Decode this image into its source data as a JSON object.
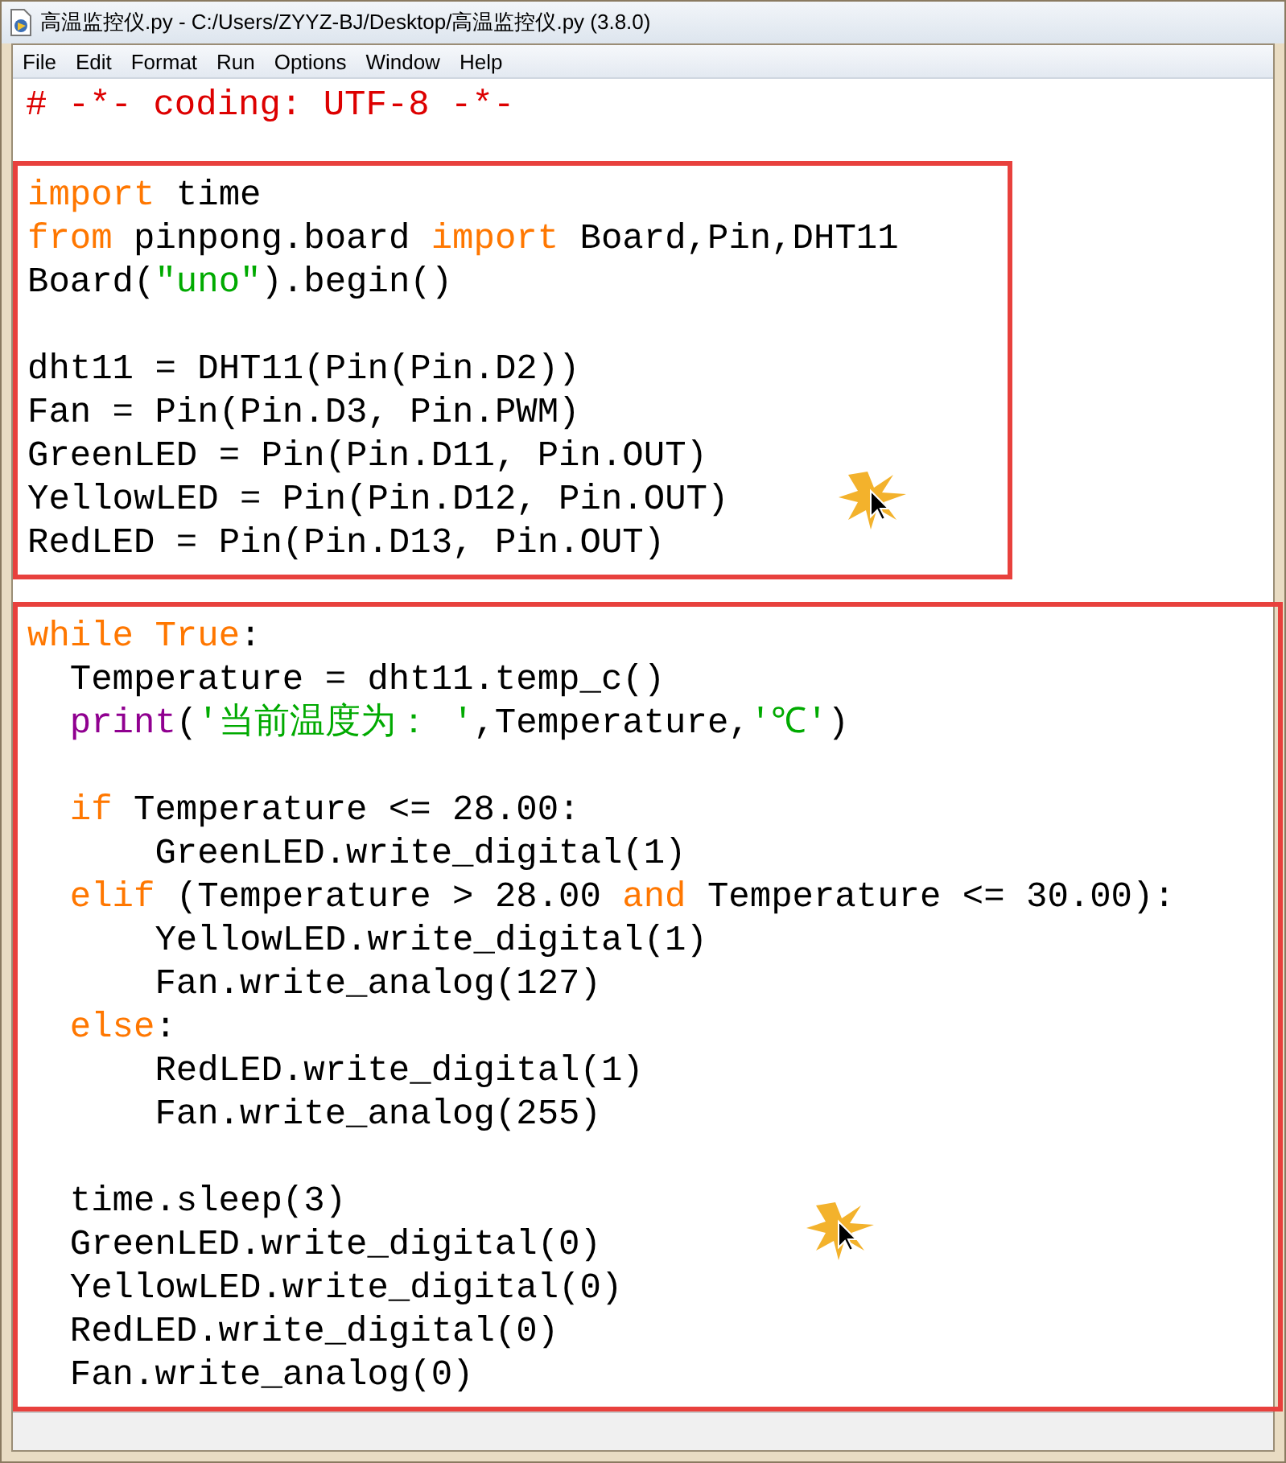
{
  "window": {
    "title": "高温监控仪.py - C:/Users/ZYYZ-BJ/Desktop/高温监控仪.py (3.8.0)"
  },
  "menu": [
    "File",
    "Edit",
    "Format",
    "Run",
    "Options",
    "Window",
    "Help"
  ],
  "header": [
    {
      "kind": "code",
      "tokens": [
        {
          "kind": "comment",
          "text": "# -*- coding: UTF-8 -*-"
        }
      ]
    },
    {
      "kind": "blank"
    }
  ],
  "sections": [
    {
      "lines": [
        {
          "kind": "code",
          "tokens": [
            {
              "kind": "keyword",
              "text": "import"
            },
            {
              "kind": "plain",
              "text": " time"
            }
          ]
        },
        {
          "kind": "code",
          "tokens": [
            {
              "kind": "keyword",
              "text": "from"
            },
            {
              "kind": "plain",
              "text": " pinpong.board "
            },
            {
              "kind": "keyword",
              "text": "import"
            },
            {
              "kind": "plain",
              "text": " Board,Pin,DHT11"
            }
          ]
        },
        {
          "kind": "code",
          "tokens": [
            {
              "kind": "plain",
              "text": "Board("
            },
            {
              "kind": "string",
              "text": "\"uno\""
            },
            {
              "kind": "plain",
              "text": ").begin()"
            }
          ]
        },
        {
          "kind": "blank"
        },
        {
          "kind": "code",
          "tokens": [
            {
              "kind": "plain",
              "text": "dht11 = DHT11(Pin(Pin.D2))"
            }
          ]
        },
        {
          "kind": "code",
          "tokens": [
            {
              "kind": "plain",
              "text": "Fan = Pin(Pin.D3, Pin.PWM)"
            }
          ]
        },
        {
          "kind": "code",
          "tokens": [
            {
              "kind": "plain",
              "text": "GreenLED = Pin(Pin.D11, Pin.OUT)"
            }
          ]
        },
        {
          "kind": "code",
          "tokens": [
            {
              "kind": "plain",
              "text": "YellowLED = Pin(Pin.D12, Pin.OUT)"
            }
          ]
        },
        {
          "kind": "code",
          "tokens": [
            {
              "kind": "plain",
              "text": "RedLED = Pin(Pin.D13, Pin.OUT)"
            }
          ]
        }
      ]
    },
    {
      "lines": [
        {
          "kind": "code",
          "tokens": [
            {
              "kind": "keyword",
              "text": "while"
            },
            {
              "kind": "keyword",
              "text": " True"
            },
            {
              "kind": "plain",
              "text": ":"
            }
          ],
          "children": [
            {
              "kind": "code",
              "tokens": [
                {
                  "kind": "plain",
                  "text": "Temperature = dht11.temp_c()"
                }
              ]
            },
            {
              "kind": "code",
              "tokens": [
                {
                  "kind": "builtin",
                  "text": "print"
                },
                {
                  "kind": "plain",
                  "text": "("
                },
                {
                  "kind": "string",
                  "text": "'当前温度为： '"
                },
                {
                  "kind": "plain",
                  "text": ",Temperature,"
                },
                {
                  "kind": "string",
                  "text": "'℃'"
                },
                {
                  "kind": "plain",
                  "text": ")"
                }
              ]
            },
            {
              "kind": "blank"
            },
            {
              "kind": "code",
              "tokens": [
                {
                  "kind": "keyword",
                  "text": "if"
                },
                {
                  "kind": "plain",
                  "text": " Temperature <= 28.00:"
                }
              ],
              "children": [
                {
                  "kind": "code",
                  "tokens": [
                    {
                      "kind": "plain",
                      "text": "GreenLED.write_digital(1)"
                    }
                  ]
                }
              ]
            },
            {
              "kind": "code",
              "tokens": [
                {
                  "kind": "keyword",
                  "text": "elif"
                },
                {
                  "kind": "plain",
                  "text": " (Temperature > 28.00 "
                },
                {
                  "kind": "keyword",
                  "text": "and"
                },
                {
                  "kind": "plain",
                  "text": " Temperature <= 30.00):"
                }
              ],
              "children": [
                {
                  "kind": "code",
                  "tokens": [
                    {
                      "kind": "plain",
                      "text": "YellowLED.write_digital(1)"
                    }
                  ]
                },
                {
                  "kind": "code",
                  "tokens": [
                    {
                      "kind": "plain",
                      "text": "Fan.write_analog(127)"
                    }
                  ]
                }
              ]
            },
            {
              "kind": "code",
              "tokens": [
                {
                  "kind": "keyword",
                  "text": "else"
                },
                {
                  "kind": "plain",
                  "text": ":"
                }
              ],
              "children": [
                {
                  "kind": "code",
                  "tokens": [
                    {
                      "kind": "plain",
                      "text": "RedLED.write_digital(1)"
                    }
                  ]
                },
                {
                  "kind": "code",
                  "tokens": [
                    {
                      "kind": "plain",
                      "text": "Fan.write_analog(255)"
                    }
                  ]
                }
              ]
            },
            {
              "kind": "blank"
            },
            {
              "kind": "code",
              "tokens": [
                {
                  "kind": "plain",
                  "text": "time.sleep(3)"
                }
              ]
            },
            {
              "kind": "code",
              "tokens": [
                {
                  "kind": "plain",
                  "text": "GreenLED.write_digital(0)"
                }
              ]
            },
            {
              "kind": "code",
              "tokens": [
                {
                  "kind": "plain",
                  "text": "YellowLED.write_digital(0)"
                }
              ]
            },
            {
              "kind": "code",
              "tokens": [
                {
                  "kind": "plain",
                  "text": "RedLED.write_digital(0)"
                }
              ]
            },
            {
              "kind": "code",
              "tokens": [
                {
                  "kind": "plain",
                  "text": "Fan.write_analog(0)"
                }
              ]
            }
          ]
        }
      ]
    }
  ]
}
